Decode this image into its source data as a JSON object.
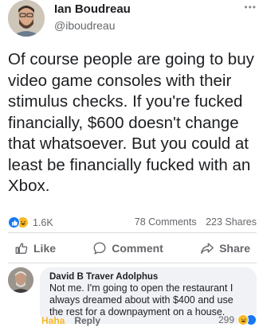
{
  "post": {
    "author_name": "Ian Boudreau",
    "author_handle": "@iboudreau",
    "more_icon": "ellipsis-icon",
    "text_lines": [
      "Of course people are going to buy",
      "video game consoles with their",
      "stimulus checks. If you're fucked",
      "financially, $600 doesn't change",
      "that whatsoever. But you could at",
      "least be financially fucked with an",
      "Xbox."
    ]
  },
  "stats": {
    "reaction_count": "1.6K",
    "comments": "78 Comments",
    "shares": "223 Shares"
  },
  "actions": {
    "like_label": "Like",
    "comment_label": "Comment",
    "share_label": "Share"
  },
  "comment": {
    "author": "David B Traver Adolphus",
    "text": "Not me. I'm going to open the restaurant I always dreamed about with $400 and use the rest for a downpayment on a house.",
    "haha_label": "Haha",
    "reply_label": "Reply",
    "reaction_count": "299"
  },
  "colors": {
    "like_blue": "#1877f2",
    "haha_yellow": "#f7b928",
    "secondary_text": "#65676b"
  }
}
